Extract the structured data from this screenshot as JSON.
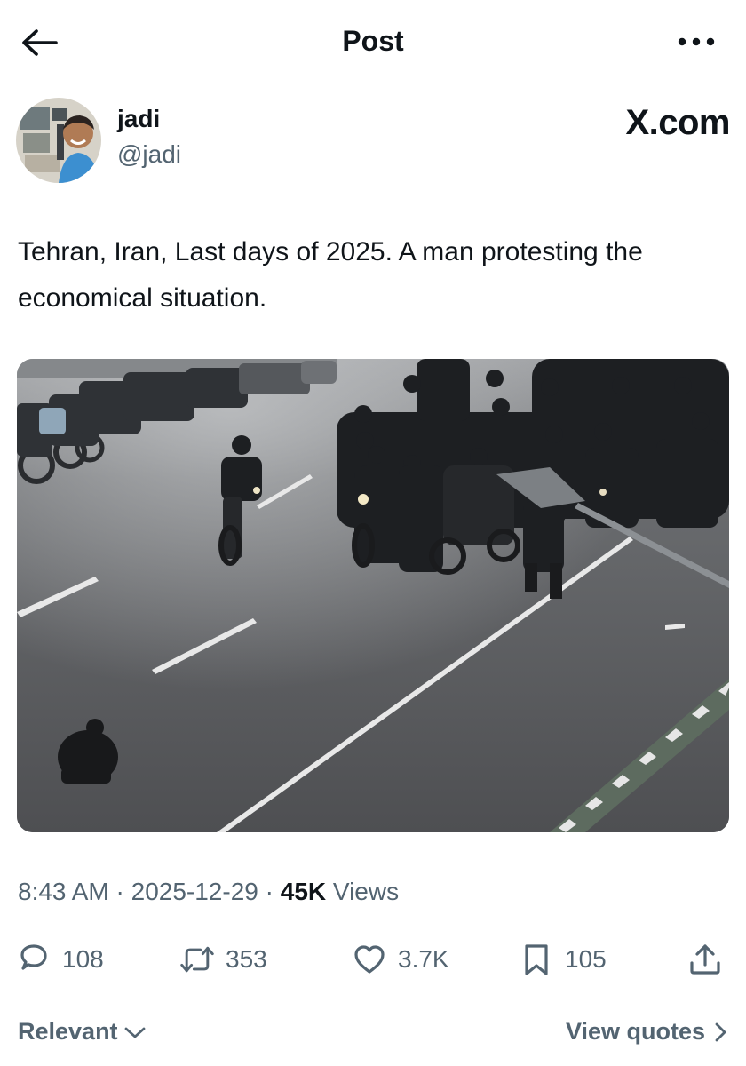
{
  "header": {
    "title": "Post",
    "back_icon": "arrow-left-icon",
    "more_icon": "more-horizontal-icon"
  },
  "author": {
    "display_name": "jadi",
    "handle": "@jadi",
    "watermark": "X.com"
  },
  "post": {
    "text": "Tehran, Iran, Last days of 2025. A man protesting the economical situation.",
    "time": "8:43 AM",
    "separator": "·",
    "date": "2025-12-29",
    "views_count": "45K",
    "views_label": "Views"
  },
  "actions": {
    "replies": "108",
    "reposts": "353",
    "likes": "3.7K",
    "bookmarks": "105"
  },
  "footer": {
    "sort_label": "Relevant",
    "view_quotes_label": "View quotes"
  },
  "colors": {
    "text": "#0f1419",
    "secondary": "#536471",
    "background": "#ffffff"
  }
}
